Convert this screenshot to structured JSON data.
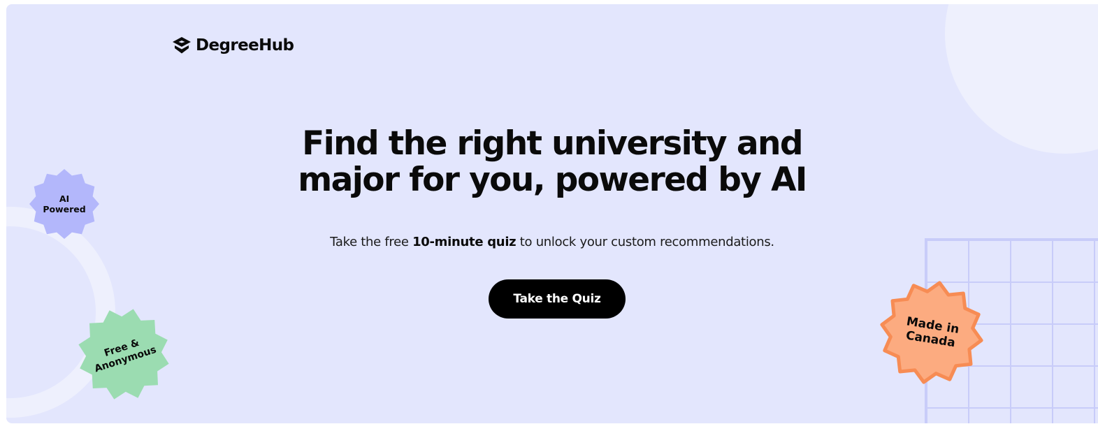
{
  "brand": {
    "name": "DegreeHub",
    "logo_icon": "graduation-cap-icon"
  },
  "hero": {
    "title_line1": "Find the right university and",
    "title_line2": "major for you, powered by AI",
    "subtitle_before": "Take the free ",
    "subtitle_bold": "10-minute quiz",
    "subtitle_after": " to unlock your custom recommendations.",
    "cta_label": "Take the Quiz"
  },
  "badges": {
    "ai_powered": {
      "label": "AI\nPowered",
      "color": "#b3b7fb"
    },
    "free_anonymous": {
      "label": "Free &\nAnonymous",
      "color": "#9bdcb1"
    },
    "made_in_canada": {
      "label": "Made in\nCanada",
      "color": "#fcab80",
      "border_color": "#f78c54"
    }
  },
  "colors": {
    "background": "#e3e6fd",
    "decoration": "#eef0fd",
    "grid_lines": "#c8ccf9",
    "cta_background": "#000000",
    "cta_text": "#ffffff",
    "text": "#0a0a0a"
  }
}
